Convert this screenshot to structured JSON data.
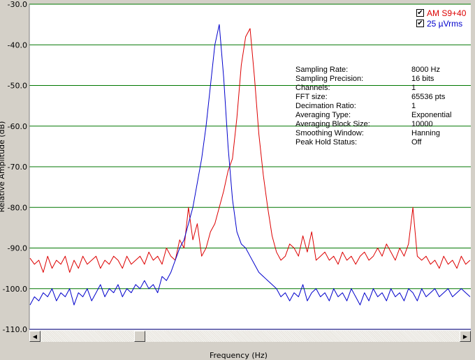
{
  "chart_data": {
    "type": "line",
    "title": "",
    "xlabel": "Frequency (Hz)",
    "ylabel": "Relative Amplitude (dB)",
    "ylim": [
      -110,
      -30
    ],
    "xlim": [
      0,
      100
    ],
    "yticks": [
      "-30.0",
      "-40.0",
      "-50.0",
      "-60.0",
      "-70.0",
      "-80.0",
      "-90.0",
      "-100.0",
      "-110.0"
    ],
    "grid": true,
    "legend_position": "top-right",
    "series": [
      {
        "name": "AM S9+40",
        "color": "#dd0000",
        "x": [
          0,
          1,
          2,
          3,
          4,
          5,
          6,
          7,
          8,
          9,
          10,
          11,
          12,
          13,
          14,
          15,
          16,
          17,
          18,
          19,
          20,
          21,
          22,
          23,
          24,
          25,
          26,
          27,
          28,
          29,
          30,
          31,
          32,
          33,
          34,
          35,
          36,
          37,
          38,
          39,
          40,
          41,
          42,
          43,
          44,
          45,
          46,
          47,
          48,
          49,
          50,
          51,
          52,
          53,
          54,
          55,
          56,
          57,
          58,
          59,
          60,
          61,
          62,
          63,
          64,
          65,
          66,
          67,
          68,
          69,
          70,
          71,
          72,
          73,
          74,
          75,
          76,
          77,
          78,
          79,
          80,
          81,
          82,
          83,
          84,
          85,
          86,
          87,
          88,
          89,
          90,
          91,
          92,
          93,
          94,
          95,
          96,
          97,
          98,
          99,
          100
        ],
        "y": [
          -92.5,
          -94,
          -93,
          -96,
          -92,
          -95,
          -93,
          -94,
          -92,
          -96,
          -93,
          -95,
          -92,
          -94,
          -93,
          -92,
          -95,
          -93,
          -94,
          -92,
          -93,
          -95,
          -92,
          -94,
          -93,
          -92,
          -94,
          -91,
          -93,
          -92,
          -94,
          -90,
          -92,
          -93,
          -88,
          -90,
          -80,
          -88,
          -84,
          -92,
          -90,
          -86,
          -84,
          -80,
          -76,
          -71,
          -68,
          -58,
          -45,
          -38,
          -36,
          -48,
          -62,
          -72,
          -80,
          -87,
          -91,
          -93,
          -92,
          -89,
          -90,
          -92,
          -87,
          -91,
          -86,
          -93,
          -92,
          -91,
          -93,
          -92,
          -94,
          -91,
          -93,
          -92,
          -94,
          -92,
          -91,
          -93,
          -92,
          -90,
          -92,
          -89,
          -91,
          -93,
          -90,
          -92,
          -89,
          -80,
          -92,
          -93,
          -92,
          -94,
          -93,
          -95,
          -92,
          -94,
          -93,
          -95,
          -92,
          -94,
          -93
        ]
      },
      {
        "name": "25 µVrms",
        "color": "#0000cc",
        "x": [
          0,
          1,
          2,
          3,
          4,
          5,
          6,
          7,
          8,
          9,
          10,
          11,
          12,
          13,
          14,
          15,
          16,
          17,
          18,
          19,
          20,
          21,
          22,
          23,
          24,
          25,
          26,
          27,
          28,
          29,
          30,
          31,
          32,
          33,
          34,
          35,
          36,
          37,
          38,
          39,
          40,
          41,
          42,
          43,
          44,
          45,
          46,
          47,
          48,
          49,
          50,
          51,
          52,
          53,
          54,
          55,
          56,
          57,
          58,
          59,
          60,
          61,
          62,
          63,
          64,
          65,
          66,
          67,
          68,
          69,
          70,
          71,
          72,
          73,
          74,
          75,
          76,
          77,
          78,
          79,
          80,
          81,
          82,
          83,
          84,
          85,
          86,
          87,
          88,
          89,
          90,
          91,
          92,
          93,
          94,
          95,
          96,
          97,
          98,
          99,
          100
        ],
        "y": [
          -104,
          -102,
          -103,
          -101,
          -102,
          -100,
          -103,
          -101,
          -102,
          -100,
          -104,
          -101,
          -102,
          -100,
          -103,
          -101,
          -99,
          -102,
          -100,
          -101,
          -99,
          -102,
          -100,
          -101,
          -99,
          -100,
          -98,
          -100,
          -99,
          -101,
          -97,
          -98,
          -96,
          -93,
          -90,
          -88,
          -84,
          -80,
          -74,
          -68,
          -60,
          -50,
          -40,
          -35,
          -48,
          -65,
          -78,
          -86,
          -89,
          -90,
          -92,
          -94,
          -96,
          -97,
          -98,
          -99,
          -100,
          -102,
          -101,
          -103,
          -101,
          -102,
          -99,
          -103,
          -101,
          -100,
          -102,
          -101,
          -103,
          -100,
          -102,
          -101,
          -103,
          -100,
          -102,
          -104,
          -101,
          -103,
          -100,
          -102,
          -101,
          -103,
          -100,
          -102,
          -101,
          -103,
          -100,
          -101,
          -103,
          -100,
          -102,
          -101,
          -100,
          -102,
          -101,
          -100,
          -102,
          -101,
          -100,
          -101,
          -102
        ]
      }
    ]
  },
  "legend": {
    "items": [
      {
        "label": "AM S9+40",
        "checked": "✔"
      },
      {
        "label": "25 µVrms",
        "checked": "✔"
      }
    ]
  },
  "info": {
    "rows": [
      {
        "key": "Sampling Rate:",
        "value": "8000 Hz"
      },
      {
        "key": "Sampling Precision:",
        "value": "16 bits"
      },
      {
        "key": "Channels:",
        "value": "1"
      },
      {
        "key": "FFT size:",
        "value": "65536 pts"
      },
      {
        "key": "Decimation Ratio:",
        "value": "1"
      },
      {
        "key": "Averaging Type:",
        "value": "Exponential"
      },
      {
        "key": "Averaging Block Size:",
        "value": "10000"
      },
      {
        "key": "Smoothing Window:",
        "value": "Hanning"
      },
      {
        "key": "Peak Hold Status:",
        "value": "Off"
      }
    ]
  },
  "scrollbar": {
    "left_arrow": "◀",
    "right_arrow": "▶",
    "position": 0.23
  },
  "colors": {
    "grid": "#007700",
    "red_series": "#dd0000",
    "blue_series": "#0000cc",
    "bottom_axis": "#000088"
  }
}
